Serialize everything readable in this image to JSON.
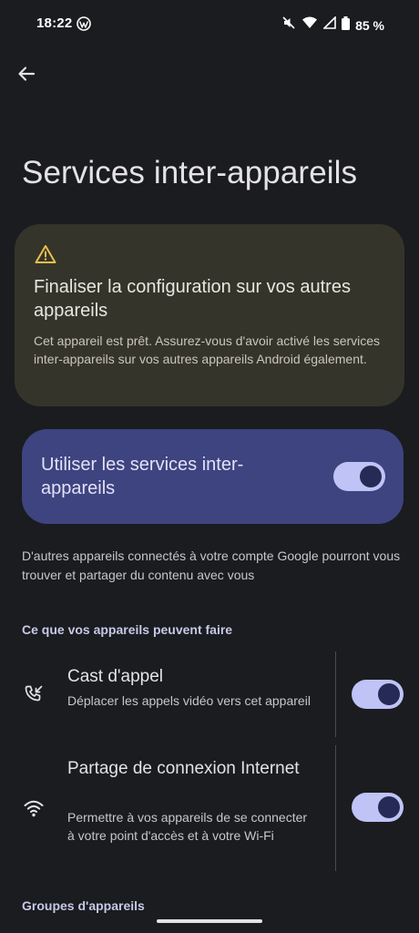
{
  "status_bar": {
    "time": "18:22",
    "battery": "85 %",
    "icons": [
      "wordpress-icon",
      "mute-icon",
      "wifi-icon",
      "cell-signal-icon",
      "battery-icon"
    ]
  },
  "page": {
    "title": "Services inter-appareils"
  },
  "warning_card": {
    "icon": "warning-icon",
    "title": "Finaliser la configuration sur vos autres appareils",
    "body": "Cet appareil est prêt. Assurez-vous d'avoir activé les services inter-appareils sur vos autres appareils Android également."
  },
  "main_toggle": {
    "label": "Utiliser les services inter-appareils",
    "on": true
  },
  "info_text": "D'autres appareils connectés à votre compte Google pourront vous trouver et partager du contenu avec vous",
  "section_capabilities": {
    "header": "Ce que vos appareils peuvent faire",
    "items": [
      {
        "icon": "call-cast-icon",
        "title": "Cast d'appel",
        "subtitle": "Déplacer les appels vidéo vers cet appareil",
        "on": true
      },
      {
        "icon": "wifi-icon",
        "title": "Partage de connexion Internet",
        "subtitle": "Permettre à vos appareils de se connecter à votre point d'accès et à votre Wi-Fi",
        "on": true
      }
    ]
  },
  "section_groups": {
    "header": "Groupes d'appareils"
  },
  "colors": {
    "background": "#1b1c1f",
    "warning_card": "#35342a",
    "toggle_card": "#3e4480",
    "switch_track": "#bfc3f5",
    "switch_thumb": "#252b55"
  }
}
